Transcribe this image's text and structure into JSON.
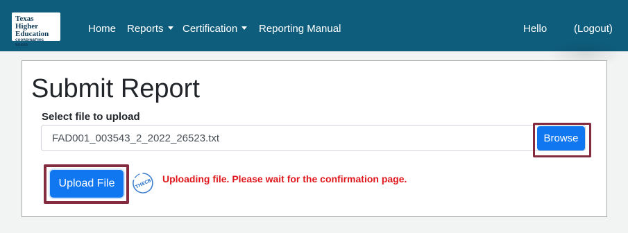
{
  "header": {
    "logo": {
      "line1": "Texas Higher",
      "line2": "Education",
      "line3": "COORDINATING BOARD"
    },
    "nav": {
      "home": "Home",
      "reports": "Reports",
      "certification": "Certification",
      "reporting_manual": "Reporting Manual"
    },
    "greeting": "Hello",
    "logout": "(Logout)"
  },
  "main": {
    "title": "Submit Report",
    "file_label": "Select file to upload",
    "file_value": "FAD001_003543_2_2022_26523.txt",
    "browse_label": "Browse",
    "upload_label": "Upload File",
    "spinner_text": "THECB",
    "status_message": "Uploading file. Please wait for the confirmation page."
  },
  "colors": {
    "navbar": "#0e5d7c",
    "primary_button": "#1177f0",
    "highlight_frame": "#852b3f",
    "status_text": "#e0161c"
  }
}
